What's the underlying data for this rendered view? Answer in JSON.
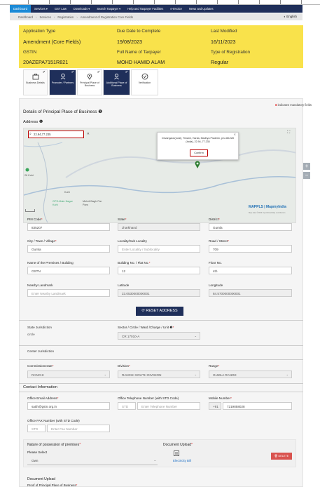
{
  "nav": {
    "items": [
      "Dashboard",
      "Services ▾",
      "GST Law",
      "Downloads ▾",
      "Search Taxpayer ▾",
      "Help and Taxpayer Facilities",
      "e-Invoice",
      "News and Updates"
    ]
  },
  "breadcrumb": {
    "items": [
      "Dashboard",
      "Services",
      "Registration",
      "Amendment of Registration Core Fields"
    ],
    "lang": "◐ English"
  },
  "info": {
    "application_type_label": "Application Type",
    "application_type": "Amendment (Core Fields)",
    "due_date_label": "Due Date to Complete",
    "due_date": "19/08/2023",
    "last_modified_label": "Last Modified",
    "last_modified": "16/11/2023",
    "gstin_label": "GSTIN",
    "gstin": "20AZEPA7151R821",
    "full_name_label": "Full Name of Taxpayer",
    "full_name": "MOHD HAMID ALAM",
    "reg_type_label": "Type of Registration",
    "reg_type": "Regular"
  },
  "tabs": [
    {
      "label": "Business Details",
      "icon": "briefcase-icon"
    },
    {
      "label": "Promoter / Partners",
      "icon": "person-icon"
    },
    {
      "label": "Principal Place of Business",
      "icon": "location-icon"
    },
    {
      "label": "Additional Place of Business",
      "icon": "person-plus-icon"
    },
    {
      "label": "Verification",
      "icon": "check-circle-icon"
    }
  ],
  "mandatory_note": "indicates mandatory fields",
  "section_title": "Details of Principal Place of Business ❶",
  "address_title": "Address ❶",
  "map": {
    "search_value": "22.94,77.235",
    "popup_text": "Devangaon(rural), Timarni, Harda, Madhya Pradesh, pin-461228 (India), 22.94, 77.235",
    "confirm_label": "Confirm",
    "labels": [
      "26 Kuhi",
      "Kuhi",
      "GPS-Main Nagar Kuhi",
      "Mehdi Bagh Par Pars"
    ],
    "brand": "MAPPLS | MapmyIndia",
    "attribution": "Map data ©2023 OpenStreetMap contributors"
  },
  "fields": {
    "pin_label": "PIN Code",
    "pin": "835207",
    "state_label": "State",
    "state": "Jharkhand",
    "district_label": "District",
    "district": "Gumla",
    "city_label": "City / Town / Village",
    "city": "Gumla",
    "locality_label": "Locality/Sub Locality",
    "locality_ph": "Enter Locality / Sublocality",
    "road_label": "Road / Street",
    "road": "709",
    "premises_label": "Name of the Premises / Building",
    "premises": "GSTN",
    "building_label": "Building No. / Flat No.",
    "building": "12",
    "floor_label": "Floor No.",
    "floor": "4th",
    "landmark_label": "Nearby Landmark",
    "landmark_ph": "Enter Nearby Landmark",
    "lat_label": "Latitude",
    "lat": "23.0530000000001",
    "long_label": "Longitude",
    "long": "84.5700000000001"
  },
  "reset_label": "⟳ RESET ADDRESS",
  "jurisdiction": {
    "state_label": "State Jurisdiction",
    "state_value": "circle",
    "sector_label": "Sector / Circle / Ward /Charge / Unit ❶",
    "sector": "CR 17010-A"
  },
  "center": {
    "title": "Center Jurisdiction",
    "comm_label": "Commissionerate",
    "comm": "RANCHI",
    "div_label": "Division",
    "div": "RANCHI SOUTH DIVISION",
    "range_label": "Range",
    "range": "GUMLA RANGE"
  },
  "contact": {
    "title": "Contact Information",
    "email_label": "Office Email Address",
    "email": "satth@gstn.org.in",
    "tel_label": "Office Telephone Number (with STD Code)",
    "tel_std": "STD",
    "tel_ph": "Enter Telephone Number",
    "mobile_label": "Mobile Number",
    "mobile_cc": "+91",
    "mobile": "7219858028",
    "fax_label": "Office FAX Number (with STD Code)",
    "fax_std": "STD",
    "fax_ph": "Enter Fax Number"
  },
  "possession": {
    "label": "Nature of possession of premises",
    "select_label": "Please Select",
    "value": "Own",
    "upload_label": "Document Upload",
    "file": "Electricity Bill",
    "delete_label": "🗑 DELETE"
  },
  "upload2": {
    "label": "Document Upload",
    "sub": "Proof of Principal Place of Business"
  },
  "colors": {
    "nav_bg": "#1f2f5a",
    "nav_active": "#1c8ad6",
    "info_bg": "#f9e24b",
    "required": "#e02020"
  }
}
